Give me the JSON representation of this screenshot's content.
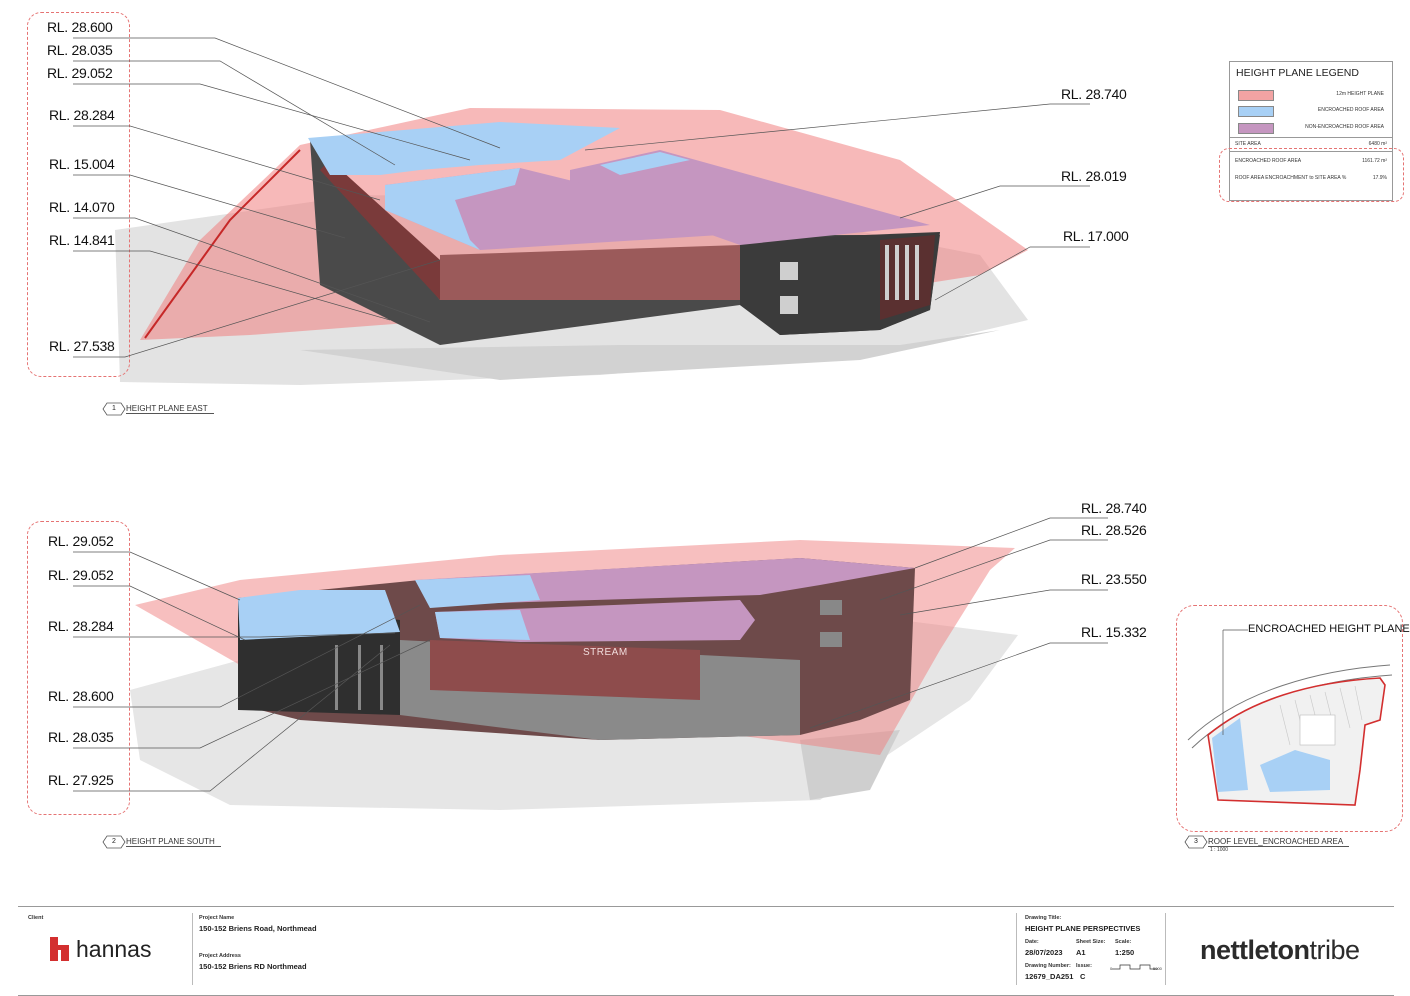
{
  "views": [
    {
      "number": "1",
      "title": "HEIGHT PLANE EAST",
      "left_labels": [
        "RL. 28.600",
        "RL. 28.035",
        "RL. 29.052",
        "RL. 28.284",
        "RL. 15.004",
        "RL. 14.070",
        "RL. 14.841",
        "RL. 27.538"
      ],
      "right_labels": [
        "RL. 28.740",
        "RL. 28.019",
        "RL. 17.000"
      ]
    },
    {
      "number": "2",
      "title": "HEIGHT PLANE SOUTH",
      "left_labels": [
        "RL. 29.052",
        "RL. 29.052",
        "RL. 28.284",
        "RL. 28.600",
        "RL. 28.035",
        "RL. 27.925"
      ],
      "right_labels": [
        "RL. 28.740",
        "RL. 28.526",
        "RL. 23.550",
        "RL. 15.332"
      ],
      "signage": "STREAM"
    },
    {
      "number": "3",
      "title": "ROOF LEVEL_ENCROACHED AREA",
      "scale_note": "1 : 1000",
      "callout": "ENCROACHED HEIGHT PLANE"
    }
  ],
  "legend": {
    "title": "HEIGHT PLANE LEGEND",
    "items": [
      {
        "label": "12m HEIGHT PLANE",
        "color": "#f2a3a3"
      },
      {
        "label": "ENCROACHED ROOF AREA",
        "color": "#a8d0f5"
      },
      {
        "label": "NON-ENCROACHED ROOF AREA",
        "color": "#c596c0"
      }
    ],
    "site_area_label": "SITE AREA",
    "site_area_value": "6480 m²",
    "encroached_label": "ENCROACHED ROOF AREA",
    "encroached_value": "1161.72 m²",
    "percent_label": "ROOF AREA ENCROACHMENT to SITE AREA %",
    "percent_value": "17.9%"
  },
  "title_block": {
    "client_label": "Client",
    "client_name": "hannas",
    "project_name_label": "Project Name",
    "project_name": "150-152 Briens Road, Northmead",
    "project_address_label": "Project Address",
    "project_address": "150-152 Briens RD Northmead",
    "drawing_title_label": "Drawing Title:",
    "drawing_title": "HEIGHT PLANE PERSPECTIVES",
    "date_label": "Date:",
    "date": "28/07/2023",
    "sheet_size_label": "Sheet Size:",
    "sheet_size": "A1",
    "scale_label": "Scale:",
    "scale": "1:250",
    "drawing_number_label": "Drawing Number:",
    "drawing_number": "12679_DA251",
    "issue_label": "Issue:",
    "issue": "C",
    "scale_bar_start": "0",
    "scale_bar_end": "5000",
    "architect_part1": "nettleton",
    "architect_part2": "tribe"
  },
  "colors": {
    "height_plane": "#f08080",
    "encroached": "#a8d0f5",
    "non_encroached": "#c596c0",
    "building_dark": "#3a3a3a",
    "cloud": "#e57373",
    "brand_red": "#d32f2f"
  }
}
